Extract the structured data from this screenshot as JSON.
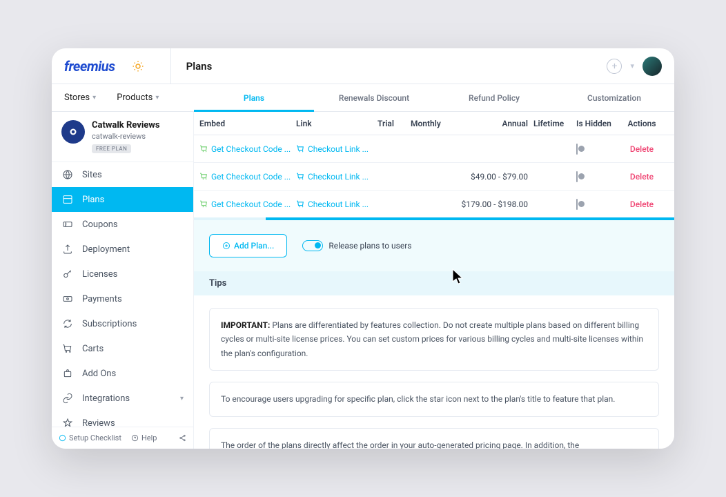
{
  "header": {
    "logo_text": "freemius",
    "title": "Plans"
  },
  "topnav": {
    "stores": "Stores",
    "products": "Products"
  },
  "tabs": [
    {
      "label": "Plans",
      "active": true
    },
    {
      "label": "Renewals Discount",
      "active": false
    },
    {
      "label": "Refund Policy",
      "active": false
    },
    {
      "label": "Customization",
      "active": false
    }
  ],
  "product": {
    "name": "Catwalk Reviews",
    "slug": "catwalk-reviews",
    "badge": "FREE PLAN"
  },
  "sidebar": {
    "items": [
      {
        "label": "Sites",
        "icon": "globe"
      },
      {
        "label": "Plans",
        "icon": "plans",
        "active": true
      },
      {
        "label": "Coupons",
        "icon": "coupon"
      },
      {
        "label": "Deployment",
        "icon": "deploy"
      },
      {
        "label": "Licenses",
        "icon": "key"
      },
      {
        "label": "Payments",
        "icon": "money"
      },
      {
        "label": "Subscriptions",
        "icon": "refresh"
      },
      {
        "label": "Carts",
        "icon": "cart"
      },
      {
        "label": "Add Ons",
        "icon": "puzzle"
      },
      {
        "label": "Integrations",
        "icon": "link",
        "chevron": true
      },
      {
        "label": "Reviews",
        "icon": "star"
      }
    ],
    "footer": {
      "setup": "Setup Checklist",
      "help": "Help"
    }
  },
  "table": {
    "headers": {
      "embed": "Embed",
      "link": "Link",
      "trial": "Trial",
      "monthly": "Monthly",
      "annual": "Annual",
      "lifetime": "Lifetime",
      "hidden": "Is Hidden",
      "actions": "Actions"
    },
    "rows": [
      {
        "embed": "Get Checkout Code ...",
        "link": "Checkout Link ...",
        "annual": "",
        "delete": "Delete"
      },
      {
        "embed": "Get Checkout Code ...",
        "link": "Checkout Link ...",
        "annual": "$49.00 - $79.00",
        "delete": "Delete"
      },
      {
        "embed": "Get Checkout Code ...",
        "link": "Checkout Link ...",
        "annual": "$179.00 - $198.00",
        "delete": "Delete"
      }
    ]
  },
  "actions": {
    "add_plan": "Add Plan...",
    "release": "Release plans to users"
  },
  "tips": {
    "title": "Tips",
    "items": [
      {
        "bold": "IMPORTANT: ",
        "text": "Plans are differentiated by features collection. Do not create multiple plans based on different billing cycles or multi-site license prices. You can set custom prices for various billing cycles and multi-site licenses within the plan's configuration."
      },
      {
        "bold": "",
        "text": "To encourage users upgrading for specific plan, click the star icon next to the plan's title to feature that plan."
      },
      {
        "bold": "",
        "text": "The order of the plans directly affect the order in your auto-generated pricing page. In addition, the"
      }
    ]
  }
}
